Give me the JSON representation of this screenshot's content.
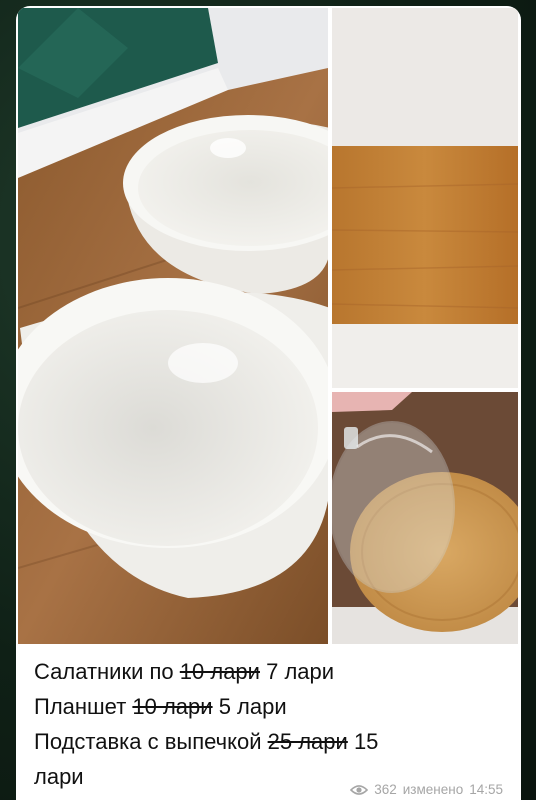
{
  "post": {
    "caption": {
      "line1": {
        "label": "Салатники по",
        "old_price": "10 лари",
        "new_price": "7 лари"
      },
      "line2": {
        "label": "Планшет",
        "old_price": "10 лари",
        "new_price": "5 лари"
      },
      "line3": {
        "label": "Подставка с выпечкой",
        "old_price": "25 лари",
        "new_price": "15",
        "new_price_cont": "лари"
      }
    },
    "meta": {
      "views": "362",
      "edited_label": "изменено",
      "time": "14:55"
    }
  },
  "icons": {
    "views": "eye-icon"
  }
}
